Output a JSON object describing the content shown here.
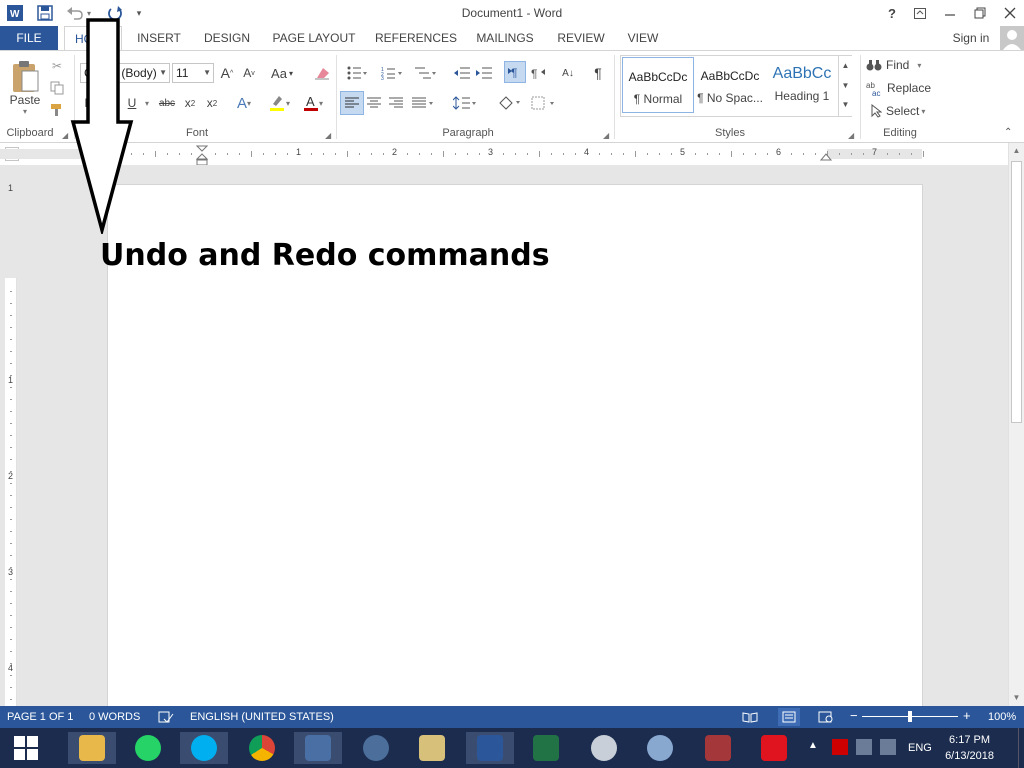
{
  "titlebar": {
    "title": "Document1 - Word",
    "help": "?",
    "sign_in": "Sign in"
  },
  "tabs": [
    {
      "label": "FILE"
    },
    {
      "label": "HOME"
    },
    {
      "label": "INSERT"
    },
    {
      "label": "DESIGN"
    },
    {
      "label": "PAGE LAYOUT"
    },
    {
      "label": "REFERENCES"
    },
    {
      "label": "MAILINGS"
    },
    {
      "label": "REVIEW"
    },
    {
      "label": "VIEW"
    }
  ],
  "ribbon": {
    "clipboard": {
      "label": "Clipboard",
      "paste": "Paste"
    },
    "font": {
      "label": "Font",
      "font_name": "Calibri (Body)",
      "font_size": "11",
      "change_case": "Aa"
    },
    "paragraph": {
      "label": "Paragraph"
    },
    "styles": {
      "label": "Styles",
      "items": [
        {
          "sample": "AaBbCcDc",
          "name": "¶ Normal"
        },
        {
          "sample": "AaBbCcDc",
          "name": "¶ No Spac..."
        },
        {
          "sample": "AaBbCc",
          "name": "Heading 1"
        }
      ]
    },
    "editing": {
      "label": "Editing",
      "find": "Find",
      "replace": "Replace",
      "select": "Select"
    }
  },
  "ruler": {
    "numbers": [
      "1",
      "1",
      "2",
      "3",
      "4",
      "5",
      "6",
      "7"
    ]
  },
  "vruler": {
    "numbers": [
      "1",
      "1",
      "2",
      "3",
      "4"
    ]
  },
  "document": {
    "heading": "Undo and Redo commands"
  },
  "statusbar": {
    "page": "PAGE 1 OF 1",
    "words": "0 WORDS",
    "language": "ENGLISH (UNITED STATES)",
    "zoom": "100%",
    "zoom_level": 100
  },
  "taskbar": {
    "language": "ENG",
    "time": "6:17 PM",
    "date": "6/13/2018"
  },
  "colors": {
    "accent": "#2b579a",
    "taskbar": "#1b2c4e"
  }
}
